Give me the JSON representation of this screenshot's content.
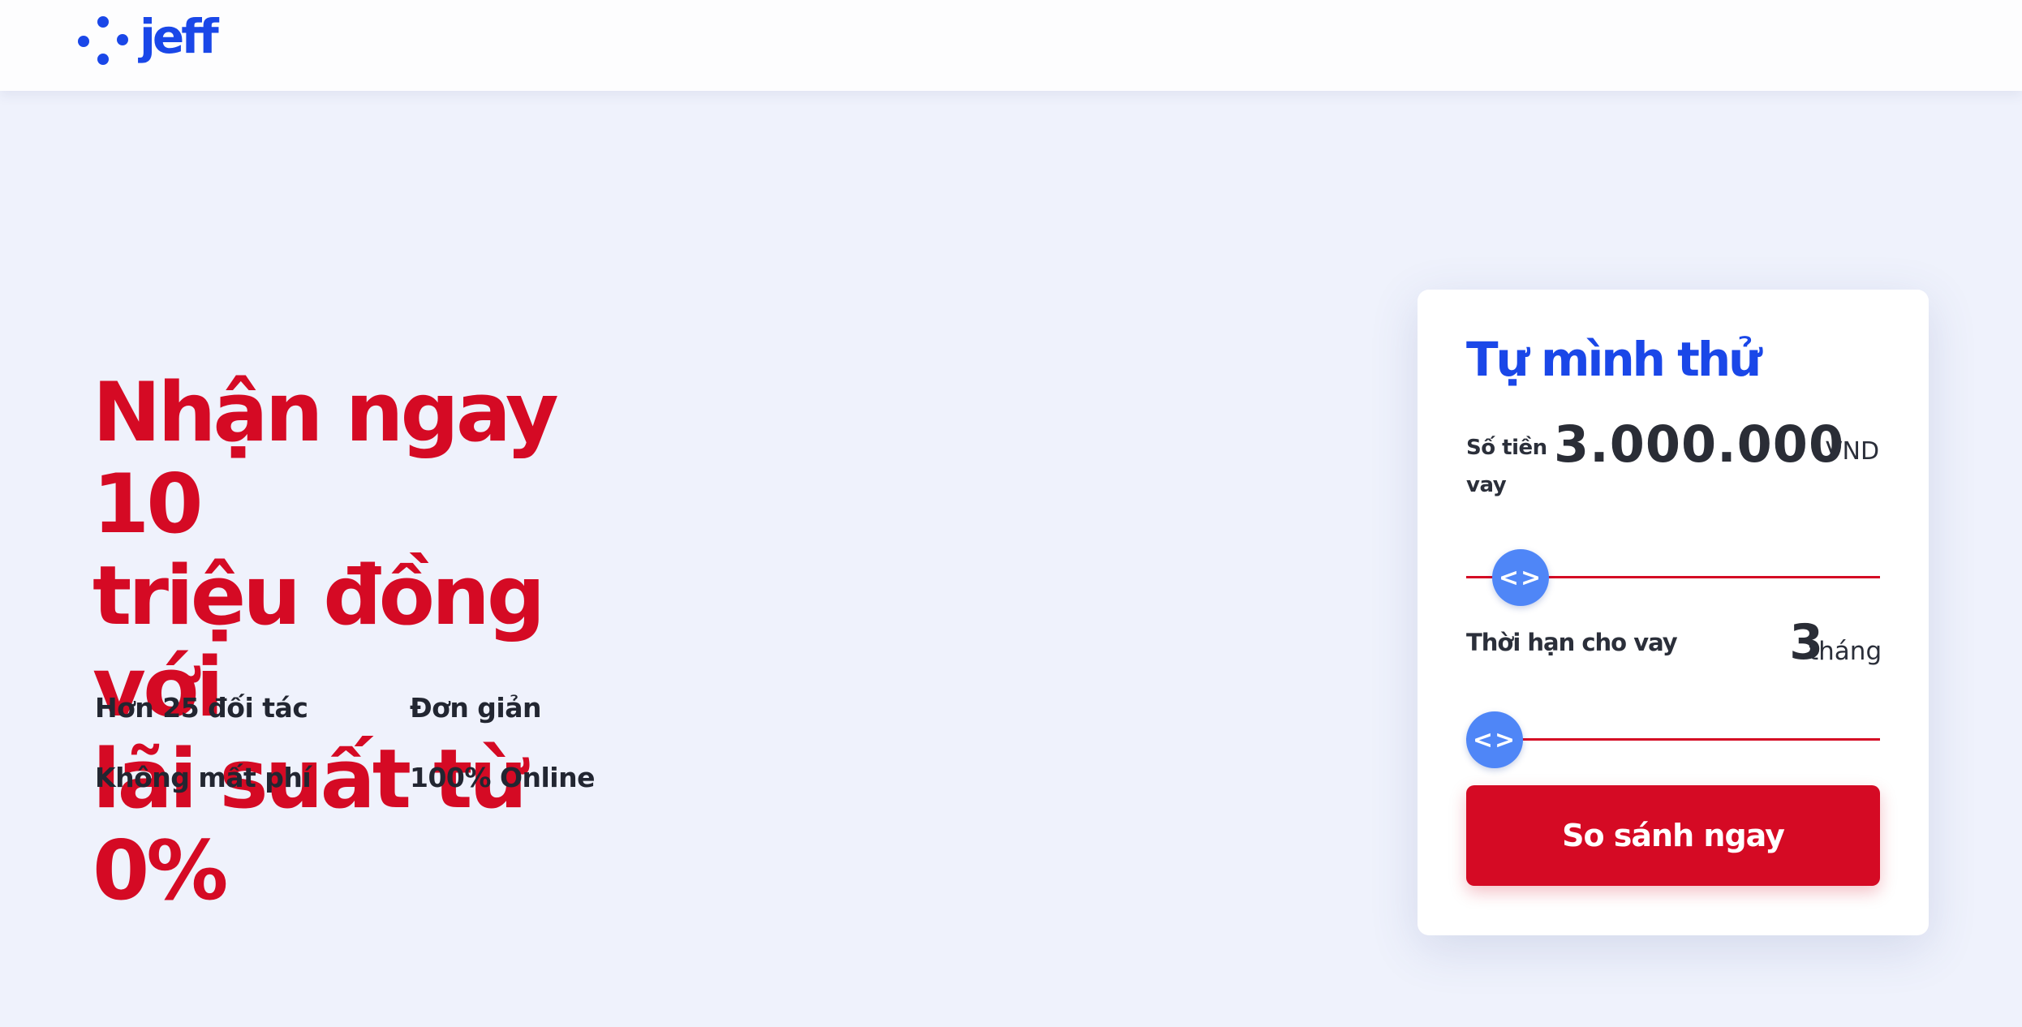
{
  "colors": {
    "brand": "#1a47e8",
    "accent": "#d50a24",
    "background": "#eff2fc"
  },
  "header": {
    "logo_text": "jeff",
    "logo_icon": "dots-logo-icon"
  },
  "hero": {
    "title_lines": [
      "Nhận ngay 10",
      "triệu đồng với",
      "lãi suất từ 0%"
    ],
    "features": [
      "Hơn 25 đối tác",
      "Đơn giản",
      "Không mất phí",
      "100% Online"
    ]
  },
  "calculator": {
    "title": "Tự mình thử",
    "amount_label_lines": [
      "Số tiền",
      "vay"
    ],
    "amount_value": "3.000.000",
    "amount_unit": "VND",
    "amount_slider_icon": "left-right-arrows-icon",
    "term_label": "Thời hạn cho vay",
    "term_value": "3",
    "term_unit": "tháng",
    "term_slider_icon": "left-right-arrows-icon",
    "thumb_glyph": "<>",
    "cta_label": "So sánh ngay"
  }
}
